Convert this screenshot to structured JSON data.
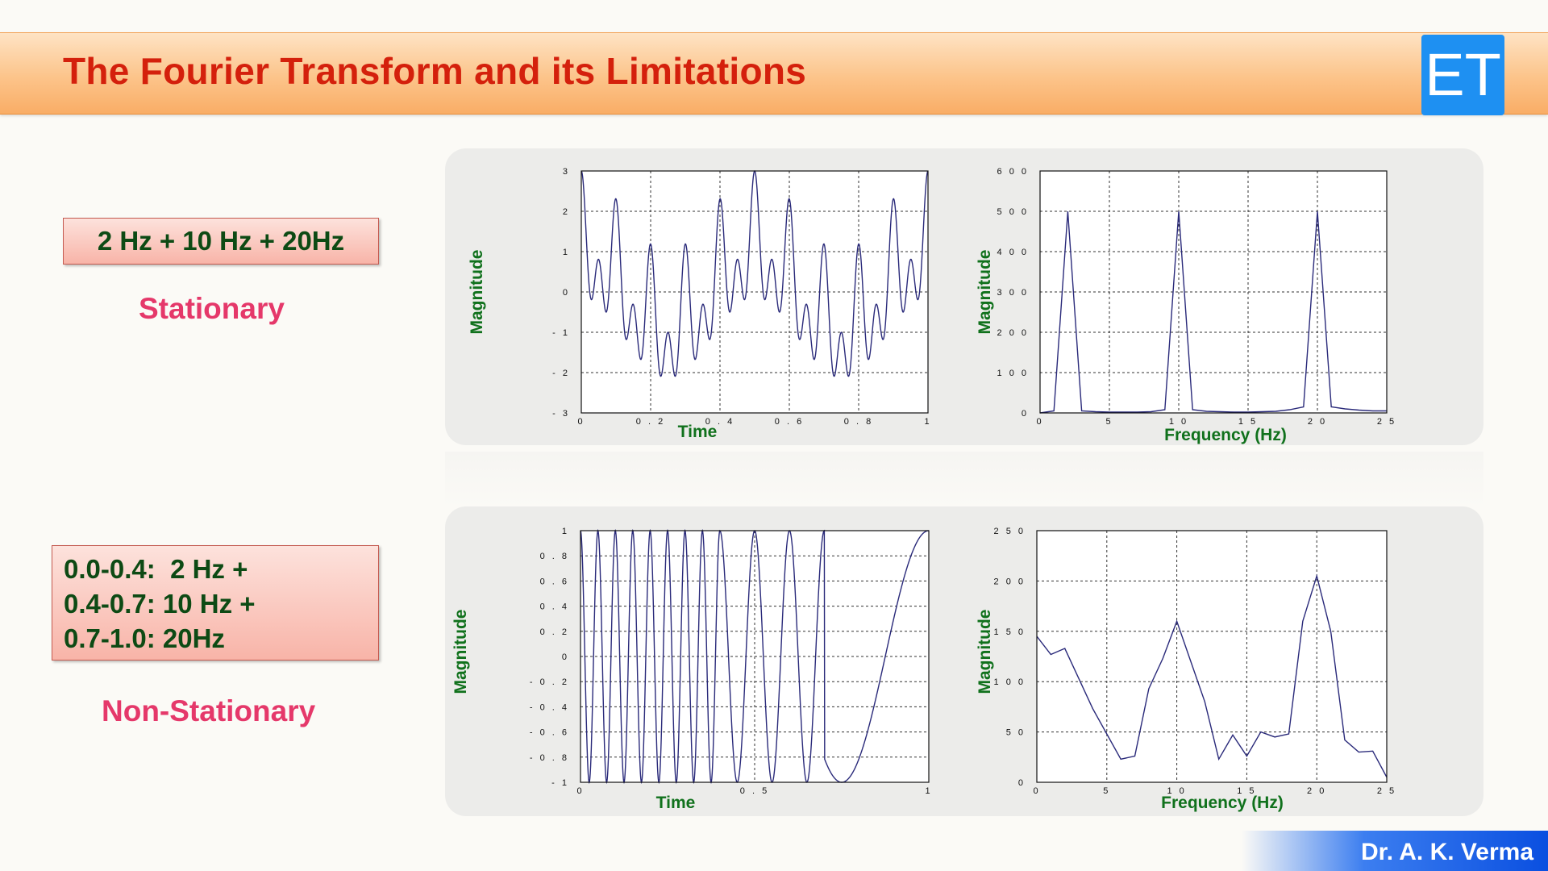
{
  "slide": {
    "title": "The Fourier Transform and its Limitations",
    "logo_text": "ET",
    "author": "Dr. A. K. Verma"
  },
  "signals": {
    "stationary": {
      "formula": "2 Hz + 10 Hz + 20Hz",
      "label": "Stationary"
    },
    "non_stationary": {
      "formula_lines": [
        "0.0-0.4:  2 Hz +",
        "0.4-0.7: 10 Hz +",
        "0.7-1.0: 20Hz"
      ],
      "label": "Non-Stationary"
    }
  },
  "colors": {
    "title": "#d4200c",
    "label_text": "#0d4a14",
    "signal_label": "#e5386a",
    "axis_label": "#10711c",
    "line": "#2a2a7a",
    "logo": "#1e90f2"
  },
  "chart_data": [
    {
      "type": "line",
      "xlabel": "Time",
      "ylabel": "Magnitude",
      "xlim": [
        0,
        1
      ],
      "ylim": [
        -3,
        3
      ],
      "xticks": [
        0,
        0.2,
        0.4,
        0.6,
        0.8,
        1
      ],
      "xticklabels": [
        "0",
        "0 . 2",
        "0 . 4",
        "0 . 6",
        "0 . 8",
        "1"
      ],
      "yticks": [
        -3,
        -2,
        -1,
        0,
        1,
        2,
        3
      ],
      "yticklabels": [
        "- 3",
        "- 2",
        "- 1",
        "0",
        "1",
        "2",
        "3"
      ],
      "grid": true,
      "signal": {
        "kind": "sum",
        "components_hz": [
          2,
          10,
          20
        ]
      }
    },
    {
      "type": "line",
      "xlabel": "Frequency (Hz)",
      "ylabel": "Magnitude",
      "xlim": [
        0,
        25
      ],
      "ylim": [
        0,
        600
      ],
      "xticks": [
        0,
        5,
        10,
        15,
        20,
        25
      ],
      "xticklabels": [
        "0",
        "5",
        "1 0",
        "1 5",
        "2 0",
        "2 5"
      ],
      "yticks": [
        0,
        100,
        200,
        300,
        400,
        500,
        600
      ],
      "yticklabels": [
        "0",
        "1 0 0",
        "2 0 0",
        "3 0 0",
        "4 0 0",
        "5 0 0",
        "6 0 0"
      ],
      "grid": true,
      "x": [
        0,
        1,
        2,
        3,
        4,
        5,
        6,
        7,
        8,
        9,
        10,
        11,
        12,
        13,
        14,
        15,
        16,
        17,
        18,
        19,
        20,
        21,
        22,
        23,
        24,
        25
      ],
      "y": [
        0,
        5,
        500,
        5,
        3,
        2,
        2,
        2,
        3,
        8,
        500,
        8,
        4,
        3,
        2,
        2,
        3,
        4,
        8,
        15,
        500,
        15,
        10,
        7,
        5,
        5
      ]
    },
    {
      "type": "line",
      "xlabel": "Time",
      "ylabel": "Magnitude",
      "xlim": [
        0,
        1
      ],
      "ylim": [
        -1,
        1
      ],
      "xticks": [
        0,
        0.5,
        1
      ],
      "xticklabels": [
        "0",
        "0 . 5",
        "1"
      ],
      "yticks": [
        -1,
        -0.8,
        -0.6,
        -0.4,
        -0.2,
        0,
        0.2,
        0.4,
        0.6,
        0.8,
        1
      ],
      "yticklabels": [
        "- 1",
        "- 0 . 8",
        "- 0 . 6",
        "- 0 . 4",
        "- 0 . 2",
        "0",
        "0 . 2",
        "0 . 4",
        "0 . 6",
        "0 . 8",
        "1"
      ],
      "grid": true,
      "signal": {
        "kind": "piecewise",
        "segments": [
          {
            "t0": 0.0,
            "t1": 0.4,
            "hz": 20
          },
          {
            "t0": 0.4,
            "t1": 0.7,
            "hz": 10
          },
          {
            "t0": 0.7,
            "t1": 1.0,
            "hz": 2
          }
        ]
      }
    },
    {
      "type": "line",
      "xlabel": "Frequency (Hz)",
      "ylabel": "Magnitude",
      "xlim": [
        0,
        25
      ],
      "ylim": [
        0,
        250
      ],
      "xticks": [
        0,
        5,
        10,
        15,
        20,
        25
      ],
      "xticklabels": [
        "0",
        "5",
        "1 0",
        "1 5",
        "2 0",
        "2 5"
      ],
      "yticks": [
        0,
        50,
        100,
        150,
        200,
        250
      ],
      "yticklabels": [
        "0",
        "5 0",
        "1 0 0",
        "1 5 0",
        "2 0 0",
        "2 5 0"
      ],
      "grid": true,
      "x": [
        0,
        1,
        2,
        3,
        4,
        5,
        6,
        7,
        8,
        9,
        10,
        11,
        12,
        13,
        14,
        15,
        16,
        17,
        18,
        19,
        20,
        21,
        22,
        23,
        24,
        25
      ],
      "y": [
        145,
        127,
        133,
        103,
        73,
        48,
        23,
        26,
        93,
        123,
        160,
        120,
        80,
        23,
        47,
        26,
        50,
        45,
        48,
        160,
        205,
        150,
        42,
        30,
        31,
        5
      ]
    }
  ]
}
